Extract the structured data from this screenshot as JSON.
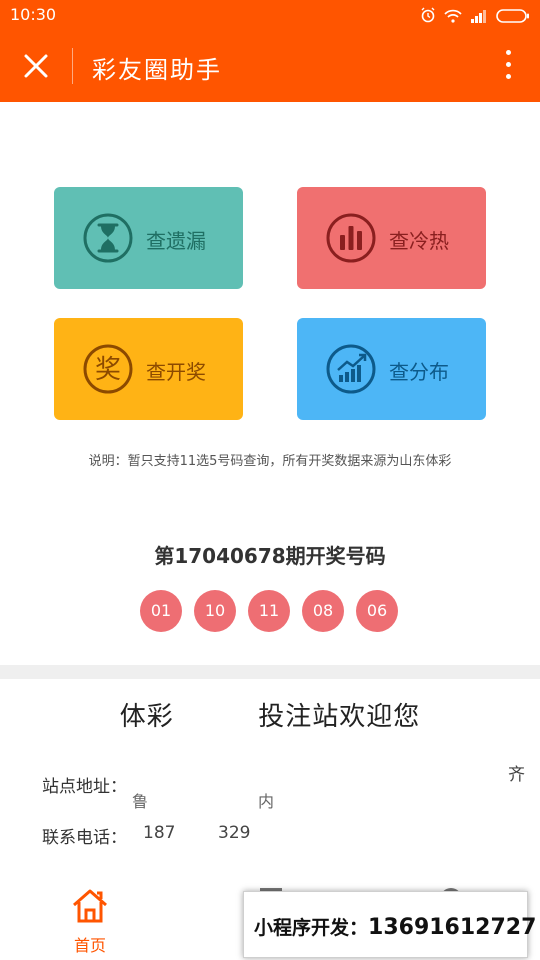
{
  "status_bar": {
    "time": "10:30"
  },
  "header": {
    "title": "彩友圈助手"
  },
  "tiles": [
    {
      "label": "查遗漏",
      "icon": "hourglass-icon"
    },
    {
      "label": "查冷热",
      "icon": "bar-chart-icon"
    },
    {
      "label": "查开奖",
      "icon": "award-icon"
    },
    {
      "label": "查分布",
      "icon": "trend-chart-icon"
    }
  ],
  "note": "说明：暂只支持11选5号码查询，所有开奖数据来源为山东体彩",
  "draw": {
    "title": "第17040678期开奖号码",
    "numbers": [
      "01",
      "10",
      "11",
      "08",
      "06"
    ]
  },
  "station": {
    "title_left": "体彩",
    "title_right": "投注站欢迎您",
    "address_label": "站点地址：",
    "address_value_1": "鲁",
    "address_value_2": "内",
    "address_value_3": "齐",
    "phone_label": "联系电话：",
    "phone_value_1": "187",
    "phone_value_2": "329"
  },
  "tabbar": {
    "home_label": "首页"
  },
  "popup": {
    "label": "小程序开发：",
    "phone": "13691612727"
  },
  "colors": {
    "brand": "#ff5500",
    "tile_missing": "#60bfb4",
    "tile_hotcold": "#f07070",
    "tile_draw": "#ffb315",
    "tile_distribution": "#4db6f6",
    "ball": "#ee6e73"
  }
}
